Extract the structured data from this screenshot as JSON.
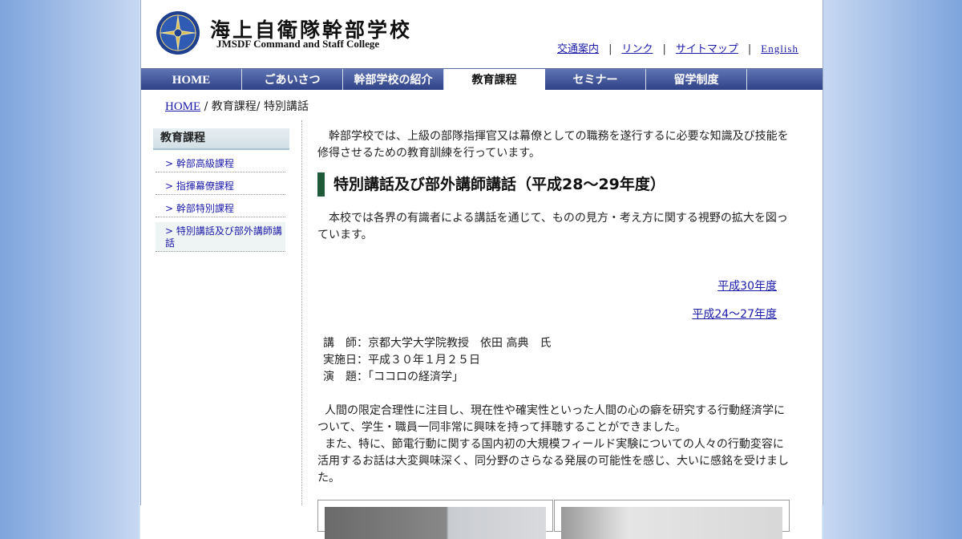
{
  "header": {
    "title": "海上自衛隊幹部学校",
    "subtitle": "JMSDF Command and Staff College",
    "util_links": [
      "交通案内",
      "リンク",
      "サイトマップ",
      "English"
    ],
    "separator": "|"
  },
  "nav": {
    "items": [
      "HOME",
      "ごあいさつ",
      "幹部学校の紹介",
      "教育課程",
      "セミナー",
      "留学制度",
      ""
    ],
    "active": "教育課程"
  },
  "breadcrumb": {
    "home": "HOME",
    "rest": " / 教育課程/ 特別講話"
  },
  "sidebar": {
    "heading": "教育課程",
    "items": [
      "> 幹部高級課程",
      "> 指揮幕僚課程",
      "> 幹部特別課程",
      "> 特別講話及び部外講師講話"
    ]
  },
  "main": {
    "intro": "幹部学校では、上級の部隊指揮官又は幕僚としての職務を遂行するに必要な知識及び技能を修得させるための教育訓練を行っています。",
    "heading": "特別講話及び部外講師講話（平成28～29年度）",
    "paragraph": "本校では各界の有識者による講話を通じて、ものの見方・考え方に関する視野の拡大を図っています。",
    "year_links": [
      "平成30年度",
      "平成24～27年度"
    ],
    "lecture": {
      "lecturer": "講　師：京都大学大学院教授　依田 高典　氏",
      "date": "実施日：平成３０年１月２５日",
      "topic": "演　題：「ココロの経済学」"
    },
    "body_lines": [
      "人間の限定合理性に注目し、現在性や確実性といった人間の心の癖を研究する行動経済学について、学生・職員一同非常に興味を持って拝聴することができました。",
      "また、特に、節電行動に関する国内初の大規模フィールド実験についての人々の行動変容に活用するお話は大変興味深く、同分野のさらなる発展の可能性を感じ、大いに感銘を受けました。"
    ]
  },
  "colors": {
    "nav_blue": "#2f4287",
    "heading_bar": "#1f5a3a",
    "link": "#1a1aa8"
  }
}
